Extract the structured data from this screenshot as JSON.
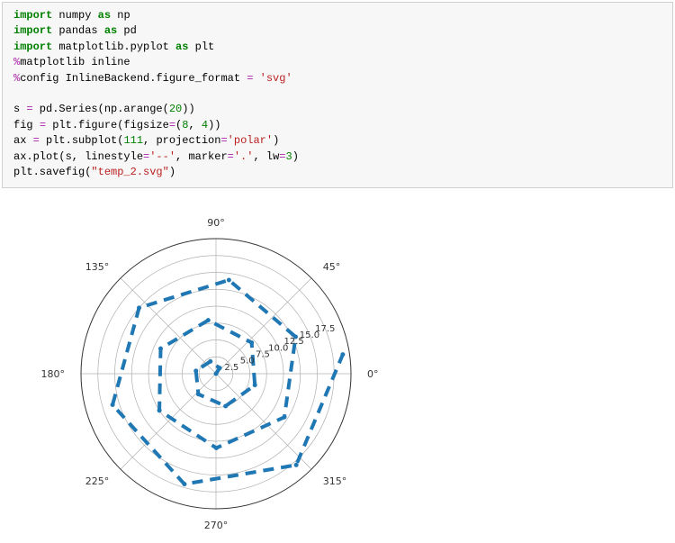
{
  "code": {
    "lines_html": [
      "<span class='kw'>import</span> numpy <span class='kw'>as</span> np",
      "<span class='kw'>import</span> pandas <span class='kw'>as</span> pd",
      "<span class='kw'>import</span> matplotlib.pyplot <span class='kw'>as</span> plt",
      "<span class='op'>%</span>matplotlib inline",
      "<span class='op'>%</span>config InlineBackend.figure_format <span class='op'>=</span> <span class='str'>'svg'</span>",
      "",
      "s <span class='op'>=</span> pd.Series(np.arange(<span class='num'>20</span>))",
      "fig <span class='op'>=</span> plt.figure(figsize<span class='op'>=</span>(<span class='num'>8</span>, <span class='num'>4</span>))",
      "ax <span class='op'>=</span> plt.subplot(<span class='num'>111</span>, projection<span class='op'>=</span><span class='str'>'polar'</span>)",
      "ax.plot(s, linestyle<span class='op'>=</span><span class='str'>'--'</span>, marker<span class='op'>=</span><span class='str'>'.'</span>, lw<span class='op'>=</span><span class='num'>3</span>)",
      "plt.savefig(<span class='str'>\"temp_2.svg\"</span>)"
    ]
  },
  "chart_data": {
    "type": "polar-line",
    "theta_deg": [
      0,
      57.3,
      114.59,
      171.89,
      229.18,
      286.48,
      343.77,
      41.07,
      98.36,
      155.66,
      212.96,
      270.25,
      327.55,
      24.84,
      82.14,
      139.43,
      196.73,
      254.03,
      311.32,
      8.62
    ],
    "r": [
      0,
      1,
      2,
      3,
      4,
      5,
      6,
      7,
      8,
      9,
      10,
      11,
      12,
      13,
      14,
      15,
      16,
      17,
      18,
      19
    ],
    "angle_ticks_deg": [
      0,
      45,
      90,
      135,
      180,
      225,
      270,
      315
    ],
    "angle_tick_labels": [
      "0°",
      "45°",
      "90°",
      "135°",
      "180°",
      "225°",
      "270°",
      "315°"
    ],
    "radial_ticks": [
      2.5,
      5.0,
      7.5,
      10.0,
      12.5,
      15.0,
      17.5
    ],
    "radial_tick_labels": [
      "2.5",
      "5.0",
      "7.5",
      "10.0",
      "12.5",
      "15.0",
      "17.5"
    ],
    "rmax": 20,
    "linestyle": "--",
    "marker": ".",
    "linewidth": 3,
    "line_color": "#1f77b4"
  }
}
